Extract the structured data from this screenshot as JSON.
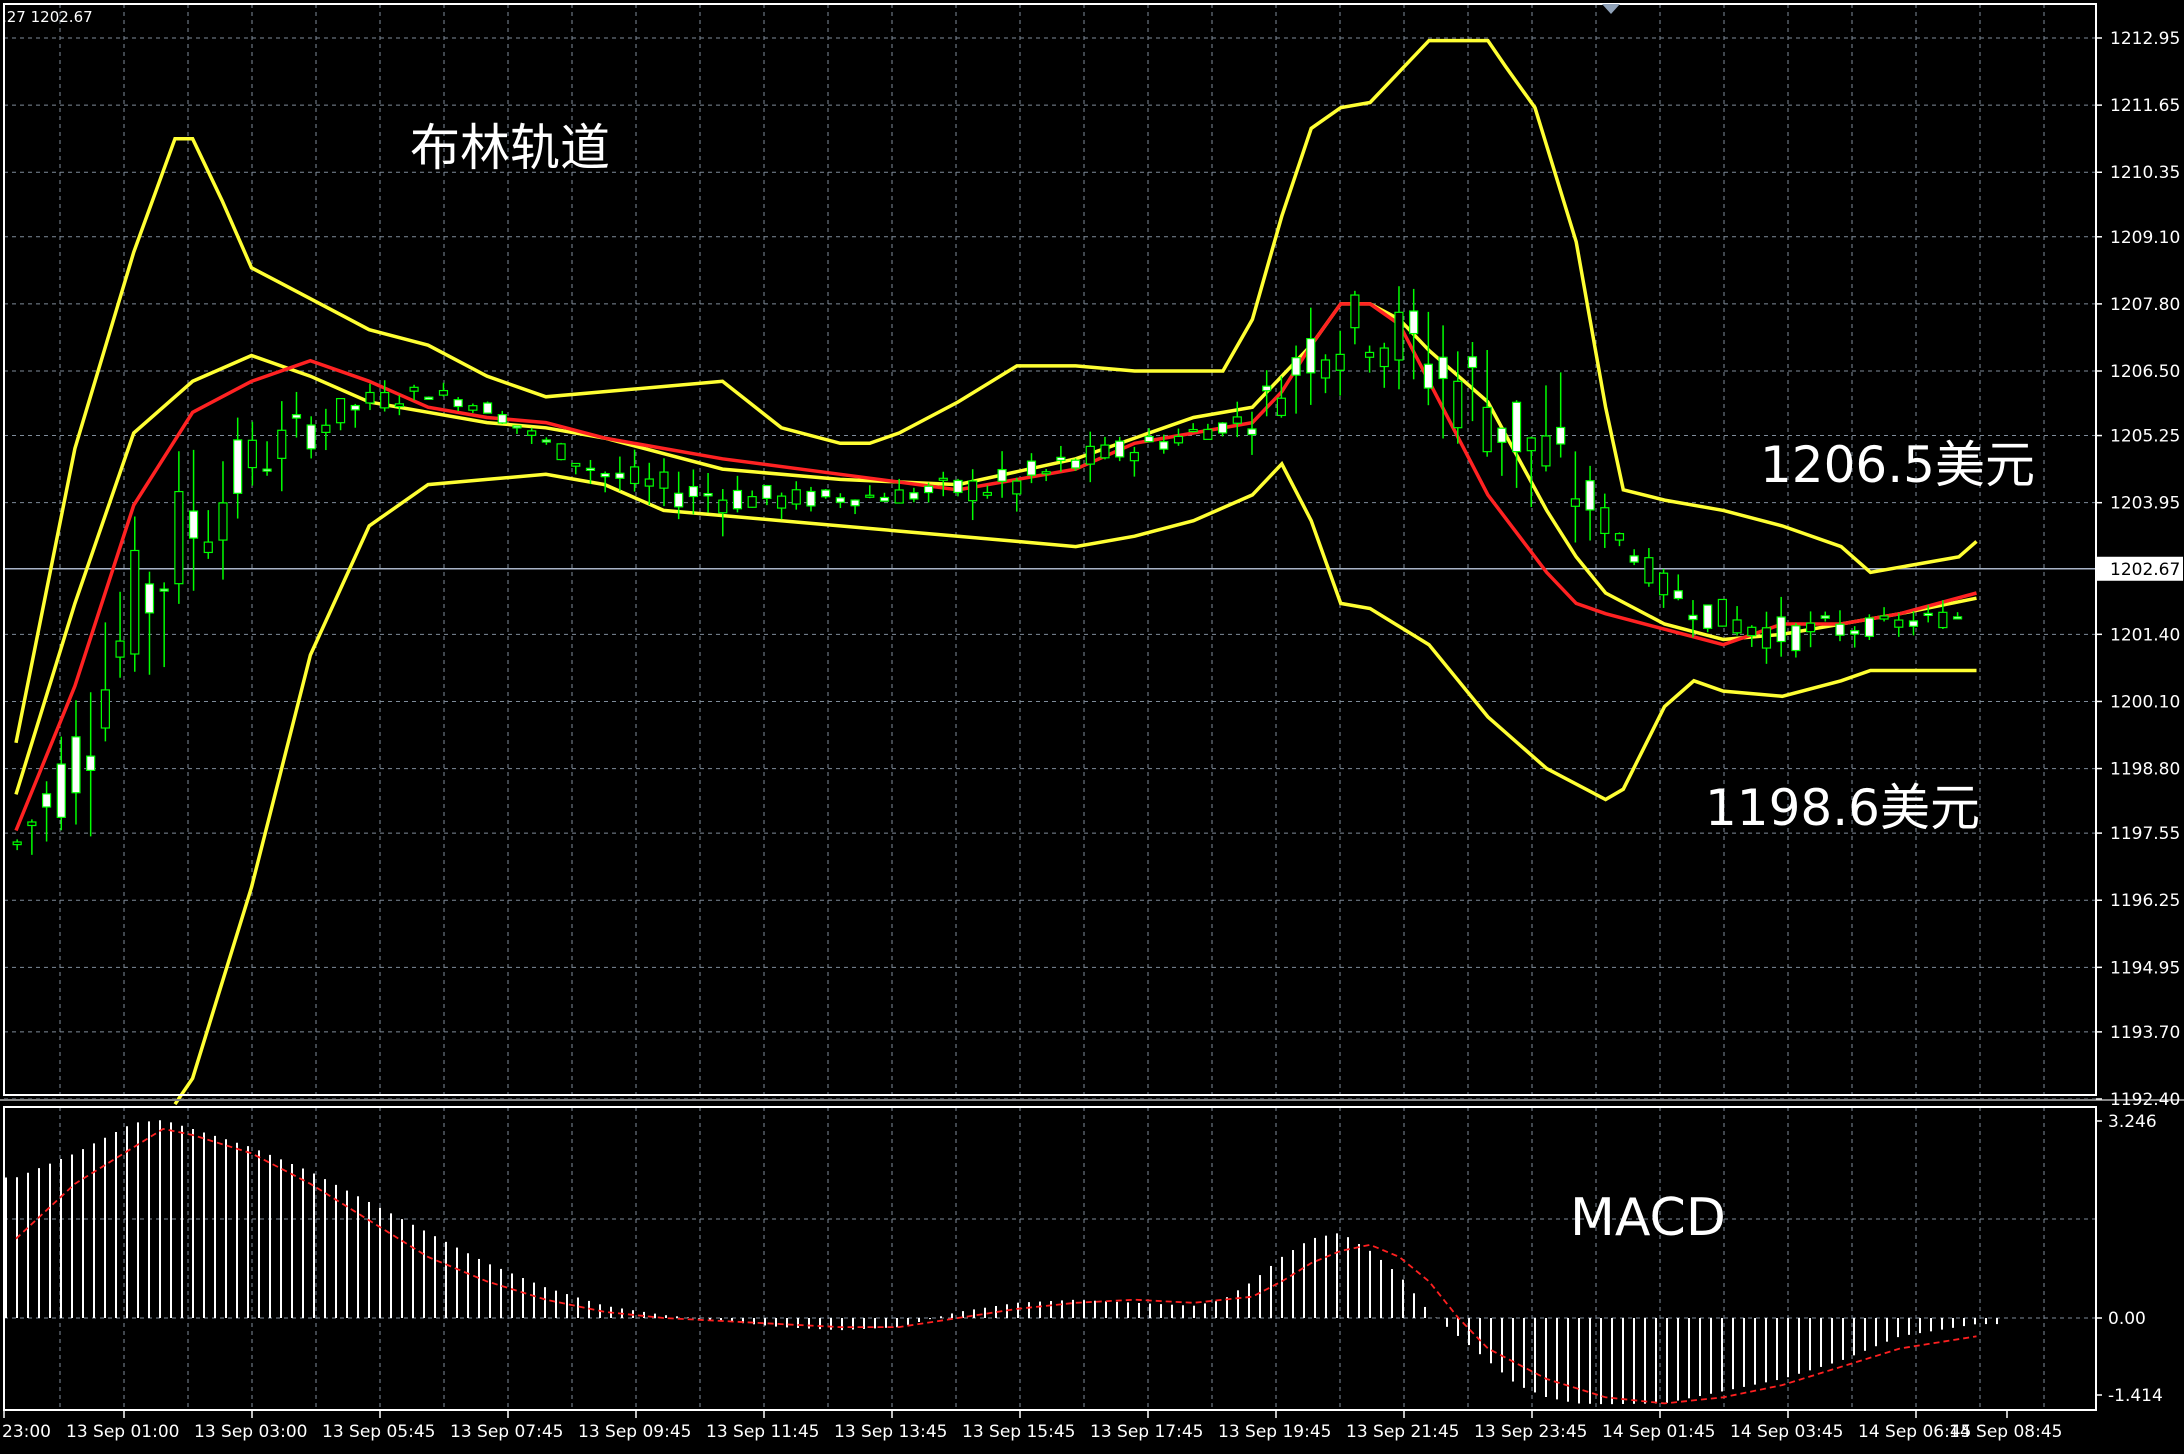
{
  "header": {
    "left_text": ",27 1202.67"
  },
  "annotations": {
    "bollinger_title": "布林轨道",
    "upper_price_label": "1206.5美元",
    "lower_price_label": "1198.6美元",
    "macd_title": "MACD"
  },
  "price_axis": {
    "ticks": [
      "1212.95",
      "1211.65",
      "1210.35",
      "1209.10",
      "1207.80",
      "1206.50",
      "1205.25",
      "1203.95",
      "1202.67",
      "1201.40",
      "1200.10",
      "1198.80",
      "1197.55",
      "1196.25",
      "1194.95",
      "1193.70",
      "1192.40"
    ],
    "current_price": "1202.67"
  },
  "macd_axis": {
    "ticks": [
      "3.246",
      "0.00",
      "-1.414"
    ]
  },
  "time_axis": {
    "ticks": [
      "23:00",
      "13 Sep 01:00",
      "13 Sep 03:00",
      "13 Sep 05:45",
      "13 Sep 07:45",
      "13 Sep 09:45",
      "13 Sep 11:45",
      "13 Sep 13:45",
      "13 Sep 15:45",
      "13 Sep 17:45",
      "13 Sep 19:45",
      "13 Sep 21:45",
      "13 Sep 23:45",
      "14 Sep 01:45",
      "14 Sep 03:45",
      "14 Sep 06:45",
      "14 Sep 08:45"
    ]
  },
  "colors": {
    "background": "#000000",
    "grid": "#7f8c9a",
    "frame": "#ffffff",
    "bullish_candle": "#00ff00",
    "bearish_candle": "#ffffff",
    "bollinger_bands": "#ffff33",
    "moving_average": "#ff2222",
    "macd_histogram": "#ffffff",
    "macd_signal": "#ff2020",
    "current_price_line": "#a8b4c8"
  },
  "chart_data": {
    "type": "candlestick",
    "instrument_price_range": [
      1192.4,
      1213.2
    ],
    "current_price": 1202.67,
    "bollinger_upper": [
      [
        23.0,
        1199.3
      ],
      [
        0.0,
        1205.0
      ],
      [
        1.0,
        1208.8
      ],
      [
        1.7,
        1211.0
      ],
      [
        2.0,
        1211.0
      ],
      [
        2.5,
        1209.8
      ],
      [
        3.0,
        1208.5
      ],
      [
        3.5,
        1208.2
      ],
      [
        4.5,
        1207.6
      ],
      [
        5.0,
        1207.3
      ],
      [
        6.0,
        1207.0
      ],
      [
        7.0,
        1206.4
      ],
      [
        8.0,
        1206.0
      ],
      [
        10.0,
        1206.2
      ],
      [
        11.0,
        1206.3
      ],
      [
        12.0,
        1205.4
      ],
      [
        13.0,
        1205.1
      ],
      [
        13.5,
        1205.1
      ],
      [
        14.0,
        1205.3
      ],
      [
        15.0,
        1205.9
      ],
      [
        16.0,
        1206.6
      ],
      [
        17.0,
        1206.6
      ],
      [
        18.0,
        1206.5
      ],
      [
        19.5,
        1206.5
      ],
      [
        20.0,
        1207.5
      ],
      [
        20.5,
        1209.5
      ],
      [
        21.0,
        1211.2
      ],
      [
        21.5,
        1211.6
      ],
      [
        22.0,
        1211.7
      ],
      [
        22.5,
        1212.3
      ],
      [
        23.0,
        1212.9
      ],
      [
        24.0,
        1212.9
      ],
      [
        24.3,
        1212.4
      ],
      [
        24.8,
        1211.6
      ],
      [
        25.5,
        1209.0
      ],
      [
        26.0,
        1205.8
      ],
      [
        26.3,
        1204.2
      ],
      [
        27.0,
        1204.0
      ],
      [
        28.0,
        1203.8
      ],
      [
        29.0,
        1203.5
      ],
      [
        30.0,
        1203.1
      ],
      [
        30.5,
        1202.6
      ],
      [
        31.0,
        1202.7
      ],
      [
        32.0,
        1202.9
      ],
      [
        32.3,
        1203.2
      ]
    ],
    "bollinger_middle": [
      [
        23.0,
        1198.3
      ],
      [
        0.0,
        1202.0
      ],
      [
        1.0,
        1205.3
      ],
      [
        2.0,
        1206.3
      ],
      [
        3.0,
        1206.8
      ],
      [
        4.0,
        1206.4
      ],
      [
        5.0,
        1205.9
      ],
      [
        6.0,
        1205.7
      ],
      [
        7.0,
        1205.5
      ],
      [
        8.0,
        1205.4
      ],
      [
        9.0,
        1205.2
      ],
      [
        11.0,
        1204.6
      ],
      [
        13.0,
        1204.4
      ],
      [
        15.0,
        1204.3
      ],
      [
        17.0,
        1204.8
      ],
      [
        18.0,
        1205.2
      ],
      [
        19.0,
        1205.6
      ],
      [
        20.0,
        1205.8
      ],
      [
        21.0,
        1207.0
      ],
      [
        21.5,
        1207.8
      ],
      [
        22.0,
        1207.8
      ],
      [
        22.5,
        1207.5
      ],
      [
        23.0,
        1206.9
      ],
      [
        24.0,
        1205.9
      ],
      [
        25.0,
        1203.8
      ],
      [
        25.5,
        1202.9
      ],
      [
        26.0,
        1202.2
      ],
      [
        27.0,
        1201.6
      ],
      [
        28.0,
        1201.3
      ],
      [
        29.0,
        1201.4
      ],
      [
        30.0,
        1201.6
      ],
      [
        31.0,
        1201.8
      ],
      [
        32.3,
        1202.1
      ]
    ],
    "bollinger_lower": [
      [
        23.0,
        1197.3
      ],
      [
        0.0,
        1199.0
      ],
      [
        1.0,
        1201.8
      ],
      [
        2.0,
        1203.5
      ],
      [
        3.0,
        1204.7
      ],
      [
        4.0,
        1205.4
      ],
      [
        5.0,
        1205.9
      ],
      [
        6.0,
        1206.1
      ],
      [
        7.0,
        1205.8
      ],
      [
        8.0,
        1205.1
      ],
      [
        9.0,
        1204.5
      ],
      [
        10.0,
        1204.2
      ],
      [
        12.0,
        1204.0
      ],
      [
        14.0,
        1204.1
      ],
      [
        16.0,
        1204.3
      ],
      [
        17.0,
        1204.7
      ],
      [
        18.0,
        1205.0
      ],
      [
        19.0,
        1205.3
      ],
      [
        20.0,
        1205.6
      ],
      [
        20.5,
        1206.2
      ],
      [
        21.0,
        1207.0
      ],
      [
        22.0,
        1207.4
      ],
      [
        23.0,
        1206.7
      ],
      [
        24.0,
        1205.9
      ],
      [
        25.0,
        1204.8
      ],
      [
        26.0,
        1203.6
      ],
      [
        27.0,
        1202.3
      ],
      [
        28.0,
        1201.7
      ],
      [
        29.0,
        1201.4
      ],
      [
        30.0,
        1201.5
      ],
      [
        31.0,
        1201.6
      ],
      [
        32.3,
        1201.8
      ]
    ],
    "bollinger_outer_lower": [
      [
        1.7,
        1192.3
      ],
      [
        2.0,
        1192.8
      ],
      [
        3.0,
        1196.5
      ],
      [
        4.0,
        1201.0
      ],
      [
        5.0,
        1203.5
      ],
      [
        6.0,
        1204.3
      ],
      [
        7.0,
        1204.4
      ],
      [
        8.0,
        1204.5
      ],
      [
        9.0,
        1204.3
      ],
      [
        10.0,
        1203.8
      ],
      [
        12.0,
        1203.6
      ],
      [
        14.0,
        1203.4
      ],
      [
        16.0,
        1203.2
      ],
      [
        17.0,
        1203.1
      ],
      [
        18.0,
        1203.3
      ],
      [
        19.0,
        1203.6
      ],
      [
        20.0,
        1204.1
      ],
      [
        20.5,
        1204.7
      ],
      [
        21.0,
        1203.6
      ],
      [
        21.5,
        1202.0
      ],
      [
        22.0,
        1201.9
      ],
      [
        23.0,
        1201.2
      ],
      [
        24.0,
        1199.8
      ],
      [
        25.0,
        1198.8
      ],
      [
        26.0,
        1198.2
      ],
      [
        26.3,
        1198.4
      ],
      [
        27.0,
        1200.0
      ],
      [
        27.5,
        1200.5
      ],
      [
        28.0,
        1200.3
      ],
      [
        29.0,
        1200.2
      ],
      [
        30.0,
        1200.5
      ],
      [
        30.5,
        1200.7
      ],
      [
        31.0,
        1200.7
      ],
      [
        32.3,
        1200.7
      ]
    ],
    "moving_average": [
      [
        23.0,
        1197.6
      ],
      [
        0.0,
        1200.4
      ],
      [
        1.0,
        1203.9
      ],
      [
        2.0,
        1205.7
      ],
      [
        3.0,
        1206.3
      ],
      [
        4.0,
        1206.7
      ],
      [
        5.0,
        1206.3
      ],
      [
        6.0,
        1205.8
      ],
      [
        7.0,
        1205.6
      ],
      [
        8.0,
        1205.5
      ],
      [
        9.0,
        1205.2
      ],
      [
        11.0,
        1204.8
      ],
      [
        13.0,
        1204.5
      ],
      [
        15.0,
        1204.2
      ],
      [
        17.0,
        1204.6
      ],
      [
        18.0,
        1205.1
      ],
      [
        19.0,
        1205.3
      ],
      [
        20.0,
        1205.5
      ],
      [
        20.5,
        1206.1
      ],
      [
        21.0,
        1207.0
      ],
      [
        21.5,
        1207.8
      ],
      [
        22.0,
        1207.8
      ],
      [
        22.5,
        1207.4
      ],
      [
        23.0,
        1206.3
      ],
      [
        24.0,
        1204.1
      ],
      [
        25.0,
        1202.6
      ],
      [
        25.5,
        1202.0
      ],
      [
        26.0,
        1201.8
      ],
      [
        27.0,
        1201.5
      ],
      [
        28.0,
        1201.2
      ],
      [
        29.0,
        1201.6
      ],
      [
        30.0,
        1201.6
      ],
      [
        31.0,
        1201.8
      ],
      [
        32.3,
        1202.2
      ]
    ],
    "macd_range": [
      -1.414,
      3.246
    ],
    "macd_histogram": [
      [
        23.0,
        2.3
      ],
      [
        0.0,
        2.7
      ],
      [
        1.0,
        3.2
      ],
      [
        1.5,
        3.246
      ],
      [
        2.0,
        3.1
      ],
      [
        3.0,
        2.8
      ],
      [
        4.0,
        2.4
      ],
      [
        5.0,
        1.9
      ],
      [
        6.0,
        1.4
      ],
      [
        7.0,
        0.9
      ],
      [
        8.0,
        0.5
      ],
      [
        9.0,
        0.2
      ],
      [
        10.0,
        0.05
      ],
      [
        11.0,
        -0.05
      ],
      [
        12.0,
        -0.15
      ],
      [
        13.0,
        -0.2
      ],
      [
        14.0,
        -0.15
      ],
      [
        15.0,
        0.1
      ],
      [
        16.0,
        0.25
      ],
      [
        17.0,
        0.3
      ],
      [
        18.0,
        0.25
      ],
      [
        19.0,
        0.2
      ],
      [
        19.5,
        0.3
      ],
      [
        20.0,
        0.6
      ],
      [
        20.5,
        1.0
      ],
      [
        21.0,
        1.3
      ],
      [
        21.5,
        1.4
      ],
      [
        22.0,
        1.1
      ],
      [
        22.5,
        0.7
      ],
      [
        23.0,
        0.1
      ],
      [
        23.5,
        -0.3
      ],
      [
        24.0,
        -0.7
      ],
      [
        24.5,
        -1.1
      ],
      [
        25.0,
        -1.3
      ],
      [
        25.5,
        -1.4
      ],
      [
        26.0,
        -1.414
      ],
      [
        27.0,
        -1.4
      ],
      [
        28.0,
        -1.2
      ],
      [
        29.0,
        -1.0
      ],
      [
        30.0,
        -0.7
      ],
      [
        31.0,
        -0.3
      ],
      [
        32.3,
        -0.1
      ]
    ],
    "macd_signal": [
      [
        23.0,
        1.3
      ],
      [
        0.0,
        2.2
      ],
      [
        1.0,
        2.8
      ],
      [
        1.5,
        3.1
      ],
      [
        2.0,
        3.0
      ],
      [
        3.0,
        2.7
      ],
      [
        4.0,
        2.2
      ],
      [
        5.0,
        1.6
      ],
      [
        6.0,
        1.0
      ],
      [
        7.0,
        0.6
      ],
      [
        8.0,
        0.3
      ],
      [
        9.0,
        0.1
      ],
      [
        10.0,
        0.0
      ],
      [
        11.0,
        -0.05
      ],
      [
        12.0,
        -0.1
      ],
      [
        13.0,
        -0.15
      ],
      [
        14.0,
        -0.15
      ],
      [
        15.0,
        0.0
      ],
      [
        16.0,
        0.15
      ],
      [
        17.0,
        0.25
      ],
      [
        18.0,
        0.3
      ],
      [
        19.0,
        0.25
      ],
      [
        20.0,
        0.35
      ],
      [
        20.5,
        0.6
      ],
      [
        21.0,
        0.9
      ],
      [
        21.5,
        1.1
      ],
      [
        22.0,
        1.2
      ],
      [
        22.5,
        1.0
      ],
      [
        23.0,
        0.6
      ],
      [
        23.5,
        0.0
      ],
      [
        24.0,
        -0.5
      ],
      [
        25.0,
        -1.0
      ],
      [
        26.0,
        -1.3
      ],
      [
        27.0,
        -1.4
      ],
      [
        28.0,
        -1.3
      ],
      [
        29.0,
        -1.1
      ],
      [
        30.0,
        -0.8
      ],
      [
        31.0,
        -0.5
      ],
      [
        32.3,
        -0.3
      ]
    ]
  }
}
